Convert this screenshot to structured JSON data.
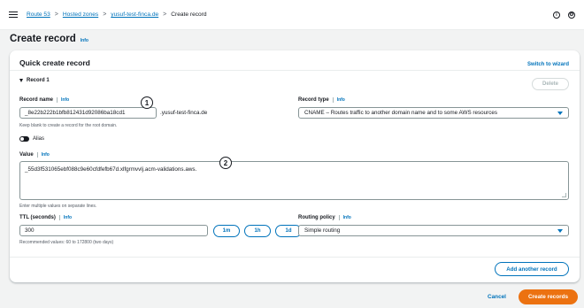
{
  "breadcrumbs": {
    "route53": "Route 53",
    "hosted_zones": "Hosted zones",
    "zone": "yusuf-test-finca.de",
    "current": "Create record"
  },
  "top_icons": {
    "info": "i",
    "settings": "⚙"
  },
  "page": {
    "title": "Create record",
    "info": "Info"
  },
  "quick_create": {
    "title": "Quick create record",
    "switch_wizard": "Switch to wizard",
    "record_label": "Record 1",
    "delete": "Delete",
    "record_name": {
      "label": "Record name",
      "info": "Info",
      "value": "_8e22b222b1bfb812431d92086ba18cd1",
      "suffix": ".yusuf-test-finca.de",
      "hint": "Keep blank to create a record for the root domain."
    },
    "record_type": {
      "label": "Record type",
      "info": "Info",
      "value": "CNAME – Routes traffic to another domain name and to some AWS resources"
    },
    "alias": {
      "label": "Alias"
    },
    "value": {
      "label": "Value",
      "info": "Info",
      "text": "_55d3f531065ebf088c9e60cfdfefb67d.xlfgrmvvlj.acm-validations.aws.",
      "hint": "Enter multiple values on separate lines."
    },
    "ttl": {
      "label": "TTL (seconds)",
      "info": "Info",
      "value": "300",
      "hint": "Recommended values: 60 to 172800 (two days)",
      "presets": [
        "1m",
        "1h",
        "1d"
      ]
    },
    "routing_policy": {
      "label": "Routing policy",
      "info": "Info",
      "value": "Simple routing"
    },
    "add_another": "Add another record"
  },
  "annotations": [
    "1",
    "2"
  ],
  "footer": {
    "cancel": "Cancel",
    "create": "Create records"
  }
}
